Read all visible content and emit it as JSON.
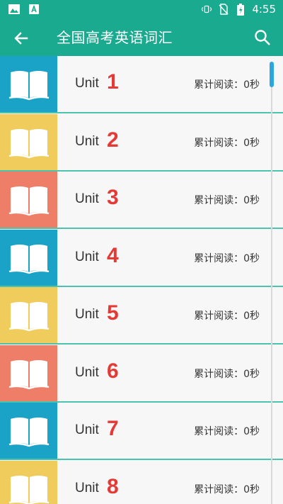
{
  "status_bar": {
    "time": "4:55",
    "icons": [
      "image-icon",
      "text-a-icon",
      "vibrate-icon",
      "no-sim-icon",
      "battery-charging-icon"
    ]
  },
  "app_bar": {
    "title": "全国高考英语词汇",
    "back_icon": "arrow-left-icon",
    "search_icon": "search-icon"
  },
  "units": [
    {
      "label": "Unit",
      "number": "1",
      "read": "累计阅读：0秒",
      "color": "#1ba2c7"
    },
    {
      "label": "Unit",
      "number": "2",
      "read": "累计阅读：0秒",
      "color": "#f0cc5c"
    },
    {
      "label": "Unit",
      "number": "3",
      "read": "累计阅读：0秒",
      "color": "#ef7e68"
    },
    {
      "label": "Unit",
      "number": "4",
      "read": "累计阅读：0秒",
      "color": "#1ba2c7"
    },
    {
      "label": "Unit",
      "number": "5",
      "read": "累计阅读：0秒",
      "color": "#f0cc5c"
    },
    {
      "label": "Unit",
      "number": "6",
      "read": "累计阅读：0秒",
      "color": "#ef7e68"
    },
    {
      "label": "Unit",
      "number": "7",
      "read": "累计阅读：0秒",
      "color": "#1ba2c7"
    },
    {
      "label": "Unit",
      "number": "8",
      "read": "累计阅读：0秒",
      "color": "#f0cc5c"
    }
  ],
  "colors": {
    "primary": "#1aaa8f",
    "divider": "#4cc3ad",
    "unit_number": "#e53935",
    "scrollbar": "#29a8e0"
  }
}
